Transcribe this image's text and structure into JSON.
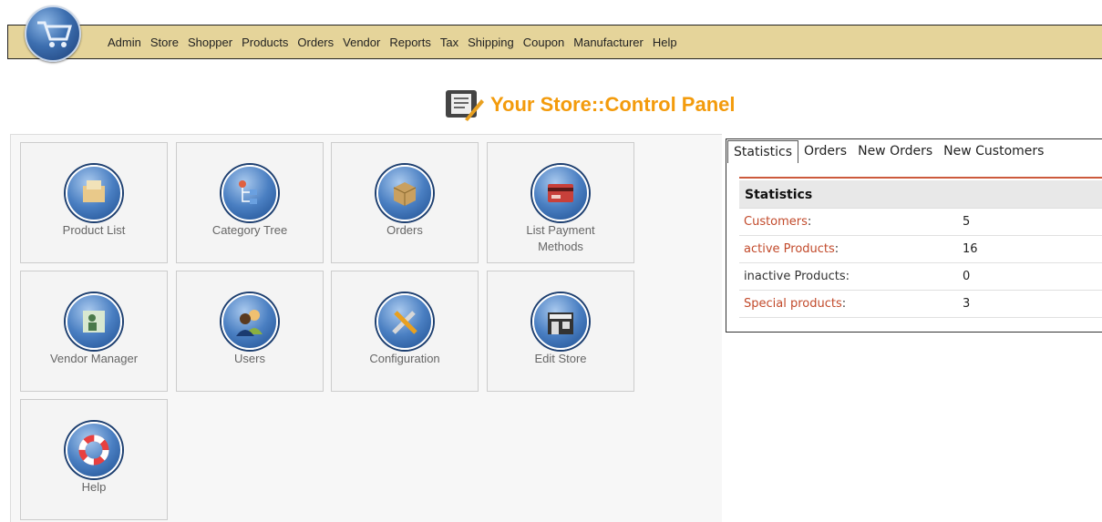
{
  "menu": {
    "items": [
      "Admin",
      "Store",
      "Shopper",
      "Products",
      "Orders",
      "Vendor",
      "Reports",
      "Tax",
      "Shipping",
      "Coupon",
      "Manufacturer",
      "Help"
    ]
  },
  "page": {
    "title": "Your Store::Control Panel"
  },
  "tiles": [
    {
      "label": "Product List",
      "icon": "product-list-icon"
    },
    {
      "label": "Category Tree",
      "icon": "category-tree-icon"
    },
    {
      "label": "Orders",
      "icon": "orders-icon"
    },
    {
      "label": "List Payment Methods",
      "icon": "payment-methods-icon"
    },
    {
      "label": "Vendor Manager",
      "icon": "vendor-manager-icon"
    },
    {
      "label": "Users",
      "icon": "users-icon"
    },
    {
      "label": "Configuration",
      "icon": "configuration-icon"
    },
    {
      "label": "Edit Store",
      "icon": "edit-store-icon"
    },
    {
      "label": "Help",
      "icon": "help-icon"
    }
  ],
  "tabs": [
    "Statistics",
    "Orders",
    "New Orders",
    "New Customers"
  ],
  "statistics": {
    "header": "Statistics",
    "rows": [
      {
        "label": "Customers",
        "suffix": ":",
        "value": "5",
        "link": true
      },
      {
        "label": "active Products",
        "suffix": ":",
        "value": "16",
        "link": true
      },
      {
        "label": "inactive Products",
        "suffix": ":",
        "value": "0",
        "link": false
      },
      {
        "label": "Special products",
        "suffix": ":",
        "value": "3",
        "link": true
      }
    ]
  },
  "colors": {
    "menu_bg": "#e5d49a",
    "title": "#f39b0c",
    "link": "#c24a2b",
    "accent_line": "#cc5a3c"
  }
}
